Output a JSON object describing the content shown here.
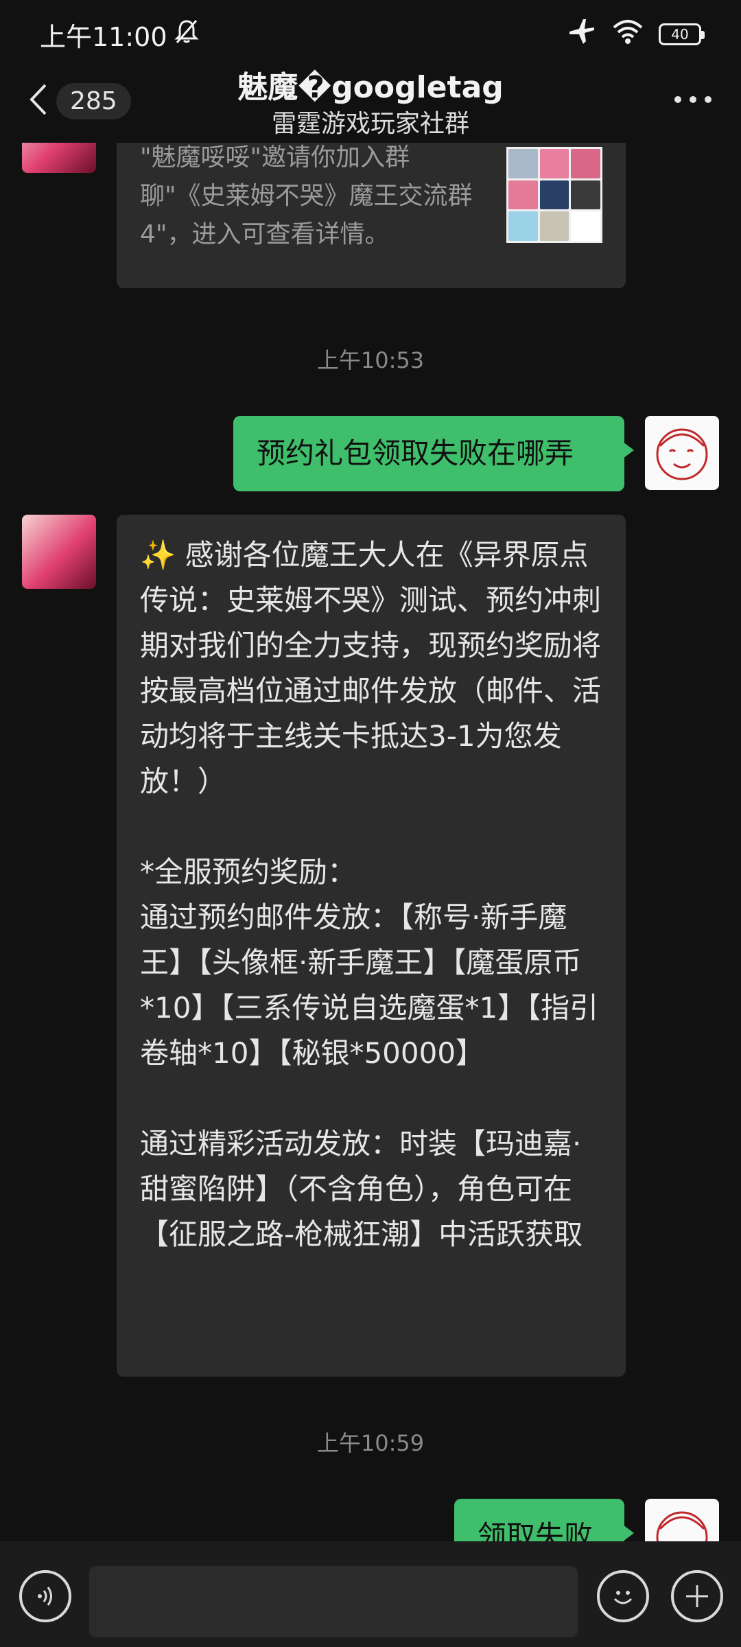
{
  "status_bar": {
    "time": "上午11:00",
    "battery": "40"
  },
  "header": {
    "unread_count": "285",
    "title": "魅魔�googletag",
    "subtitle": "雷霆游戏玩家社群"
  },
  "messages": {
    "invite": {
      "text": "\"魅魔哸哸\"邀请你加入群聊\"《史莱姆不哭》魔王交流群4\"，进入可查看详情。"
    },
    "time1": "上午10:53",
    "user_msg1": "预约礼包领取失败在哪弄",
    "bot_long": "✨ 感谢各位魔王大人在《异界原点传说：史莱姆不哭》测试、预约冲刺期对我们的全力支持，现预约奖励将按最高档位通过邮件发放（邮件、活动均将于主线关卡抵达3-1为您发放！）\n\n*全服预约奖励：\n通过预约邮件发放：【称号·新手魔王】【头像框·新手魔王】【魔蛋原币*10】【三系传说自选魔蛋*1】【指引卷轴*10】【秘银*50000】\n\n通过精彩活动发放：时装【玛迪嘉·甜蜜陷阱】（不含角色），角色可在【征服之路-枪械狂潮】中活跃获取",
    "time2": "上午10:59",
    "user_msg2": "领取失败"
  },
  "colors": {
    "bubble_out": "#3fbf6b",
    "bubble_in": "#2c2c2c",
    "background": "#111111"
  }
}
